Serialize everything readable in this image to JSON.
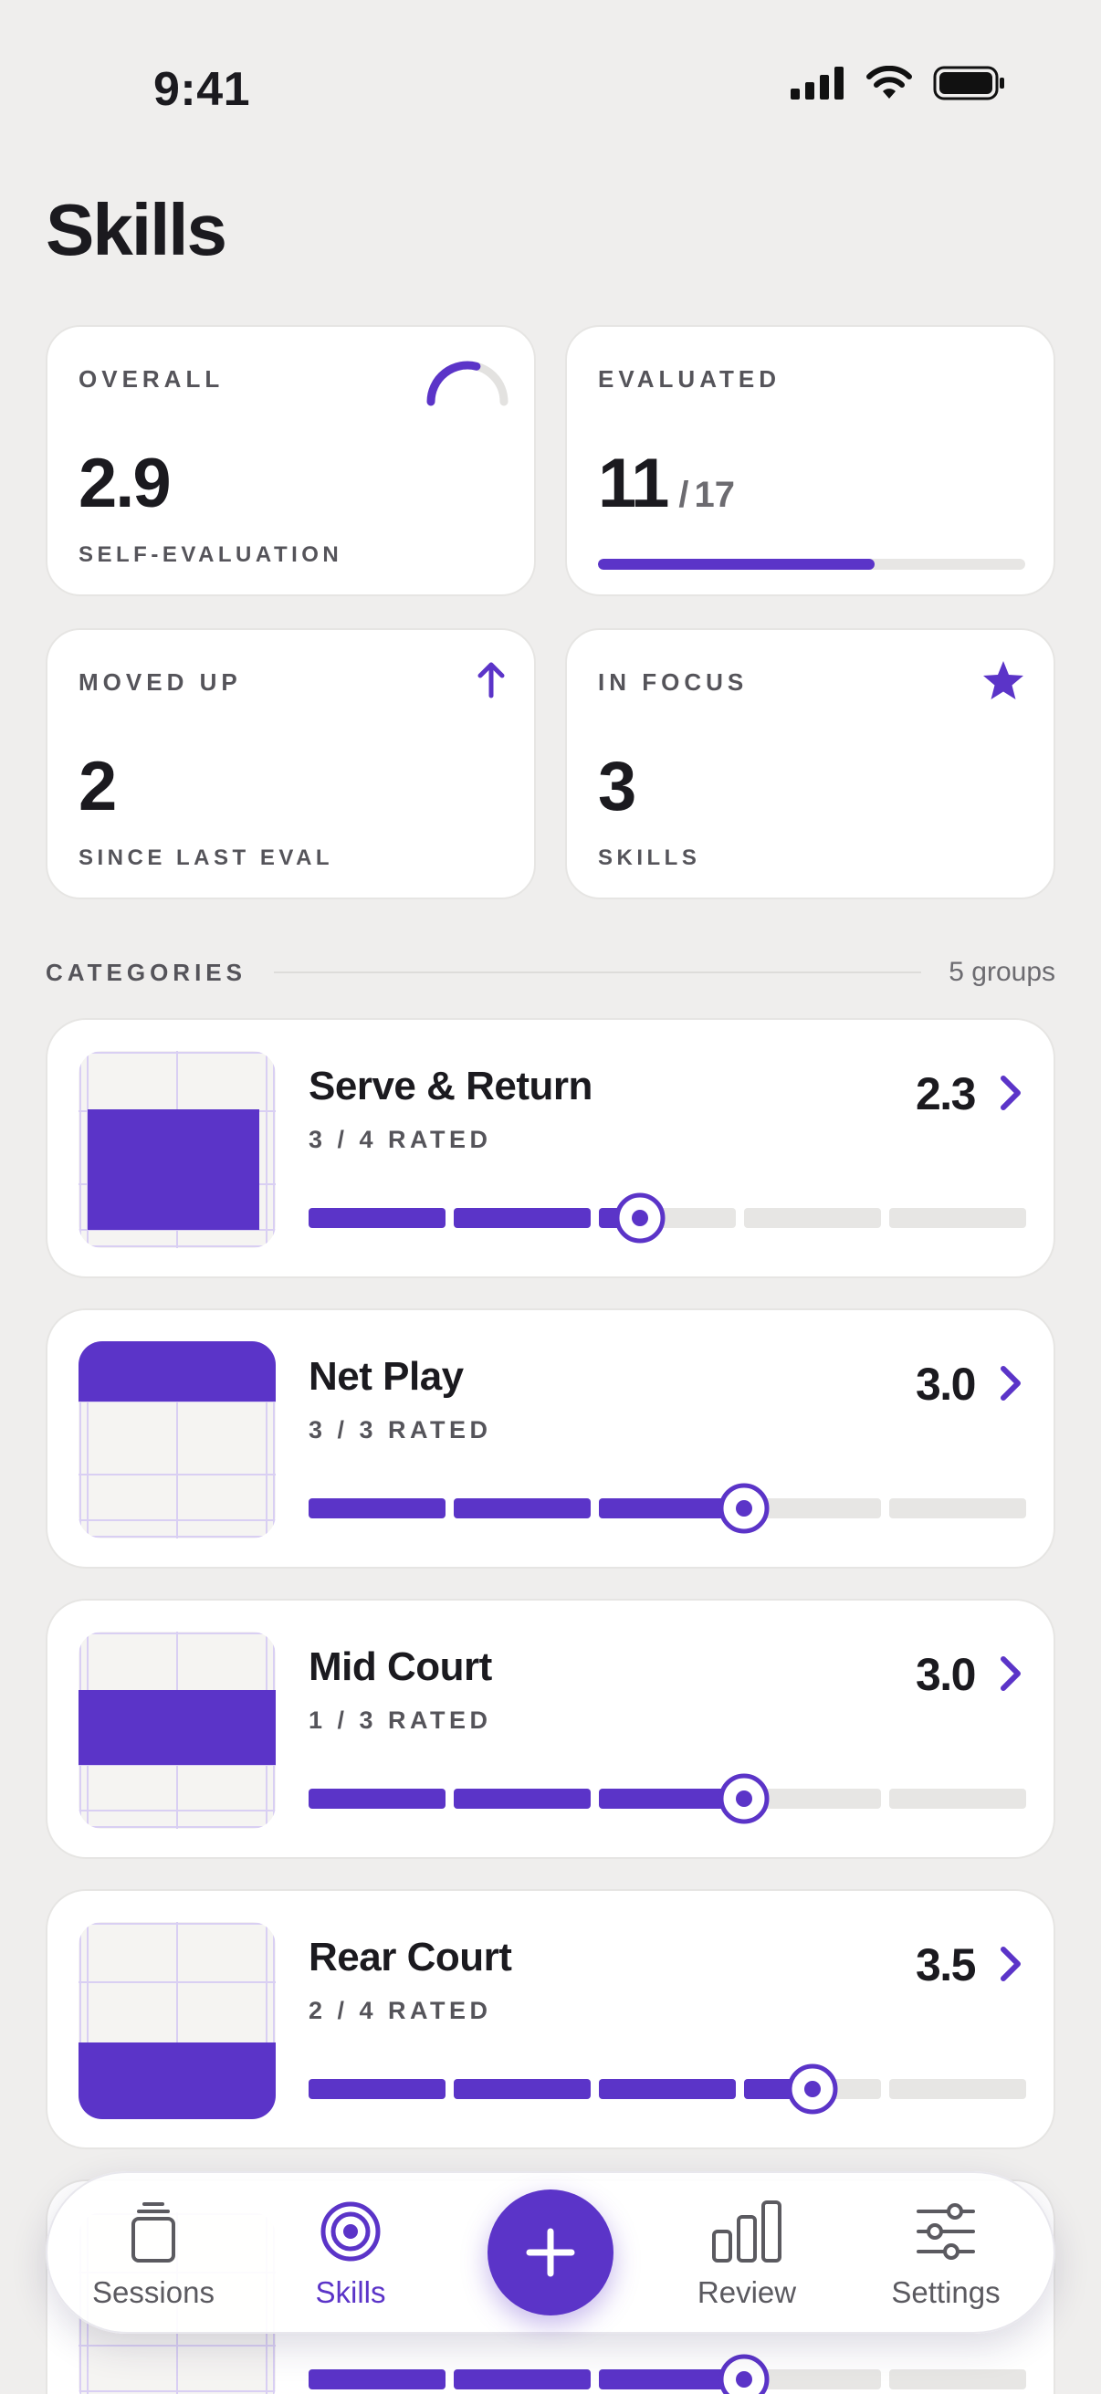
{
  "status": {
    "time": "9:41"
  },
  "page": {
    "title": "Skills"
  },
  "colors": {
    "accent": "#5b34c8",
    "background": "#efeeed",
    "track": "#e7e6e4"
  },
  "stats": {
    "overall": {
      "label": "OVERALL",
      "value": "2.9",
      "sub": "SELF-EVALUATION",
      "icon": "gauge-icon",
      "fraction": 0.58
    },
    "evaluated": {
      "label": "EVALUATED",
      "value": "11",
      "total": "17",
      "progress": 0.647
    },
    "moved_up": {
      "label": "MOVED UP",
      "value": "2",
      "sub": "SINCE LAST EVAL",
      "icon": "arrow-up-icon"
    },
    "in_focus": {
      "label": "IN FOCUS",
      "value": "3",
      "sub": "SKILLS",
      "icon": "star-icon"
    }
  },
  "categories_section": {
    "title": "CATEGORIES",
    "count": "5 groups"
  },
  "categories": [
    {
      "name": "Serve & Return",
      "rated": "3 / 4 RATED",
      "score": "2.3",
      "level": 2.3,
      "zone": "serve"
    },
    {
      "name": "Net Play",
      "rated": "3 / 3 RATED",
      "score": "3.0",
      "level": 3.0,
      "zone": "net"
    },
    {
      "name": "Mid Court",
      "rated": "1 / 3 RATED",
      "score": "3.0",
      "level": 3.0,
      "zone": "mid"
    },
    {
      "name": "Rear Court",
      "rated": "2 / 4 RATED",
      "score": "3.5",
      "level": 3.5,
      "zone": "rear"
    },
    {
      "name": "",
      "rated": "",
      "score": "",
      "level": 3.0,
      "zone": "other"
    }
  ],
  "tabbar": {
    "tabs": [
      {
        "label": "Sessions",
        "icon": "sessions-icon"
      },
      {
        "label": "Skills",
        "icon": "target-icon",
        "active": true
      },
      {
        "label": "Review",
        "icon": "bar-chart-icon"
      },
      {
        "label": "Settings",
        "icon": "sliders-icon"
      }
    ],
    "fab_icon": "plus-icon"
  }
}
